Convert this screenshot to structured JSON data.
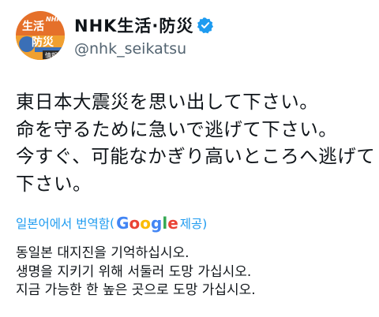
{
  "account": {
    "display_name": "NHK生活·防災",
    "handle": "@nhk_seikatsu",
    "avatar_text": [
      "生",
      "活",
      "防",
      "災",
      "情報",
      "NHK"
    ],
    "verified_color": "#1d9bf0"
  },
  "tweet": {
    "lines": [
      "東日本大震災を思い出して下さい。",
      "命を守るために急いで逃げて下さい。",
      "今すぐ、可能なかぎり高いところへ逃げて",
      "下さい。"
    ]
  },
  "translation": {
    "prefix": "일본어에서 번역함",
    "paren_open": "(",
    "google_letters": [
      "G",
      "o",
      "o",
      "g",
      "l",
      "e"
    ],
    "suffix": "제공)",
    "lines": [
      "동일본 대지진을 기억하십시오.",
      "생명을 지키기 위해 서둘러 도망 가십시오.",
      "지금 가능한 한 높은 곳으로 도망 가십시오."
    ],
    "link_color": "#1d9bf0"
  }
}
